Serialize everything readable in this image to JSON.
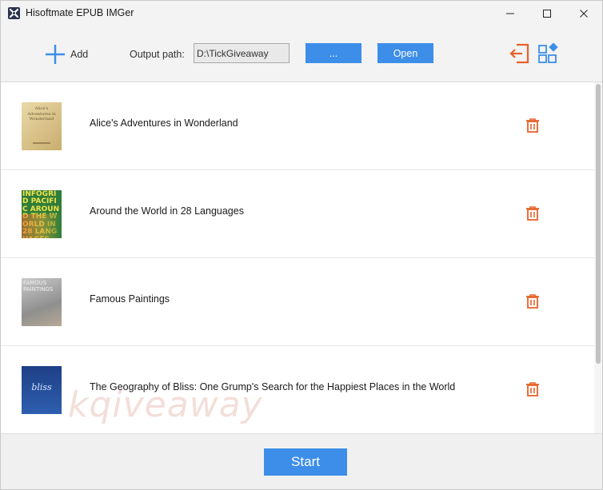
{
  "window": {
    "title": "Hisoftmate EPUB IMGer"
  },
  "toolbar": {
    "add_label": "Add",
    "output_label": "Output path:",
    "output_value": "D:\\TickGiveaway",
    "browse_label": "...",
    "open_label": "Open"
  },
  "books": [
    {
      "title": "Alice's Adventures in Wonderland",
      "cover_text": "Alice's Adventures in Wonderland"
    },
    {
      "title": "Around the World in 28 Languages",
      "cover_text": "INFOGRID PACIFIC AROUND THE WORLD IN 28 LANGUAGES"
    },
    {
      "title": "Famous Paintings",
      "cover_text": "FAMOUS PAINTINGS"
    },
    {
      "title": "The Geography of Bliss: One Grump's Search for the Happiest Places in the World",
      "cover_text": "bliss"
    }
  ],
  "watermark": "kqiveaway",
  "footer": {
    "start_label": "Start"
  },
  "colors": {
    "accent": "#3d8ee8",
    "icon_orange": "#e8622a",
    "icon_blue": "#3d8ee8"
  },
  "icons": [
    "app-icon",
    "minimize-icon",
    "maximize-icon",
    "close-icon",
    "plus-icon",
    "exit-icon",
    "apps-icon",
    "trash-icon"
  ]
}
